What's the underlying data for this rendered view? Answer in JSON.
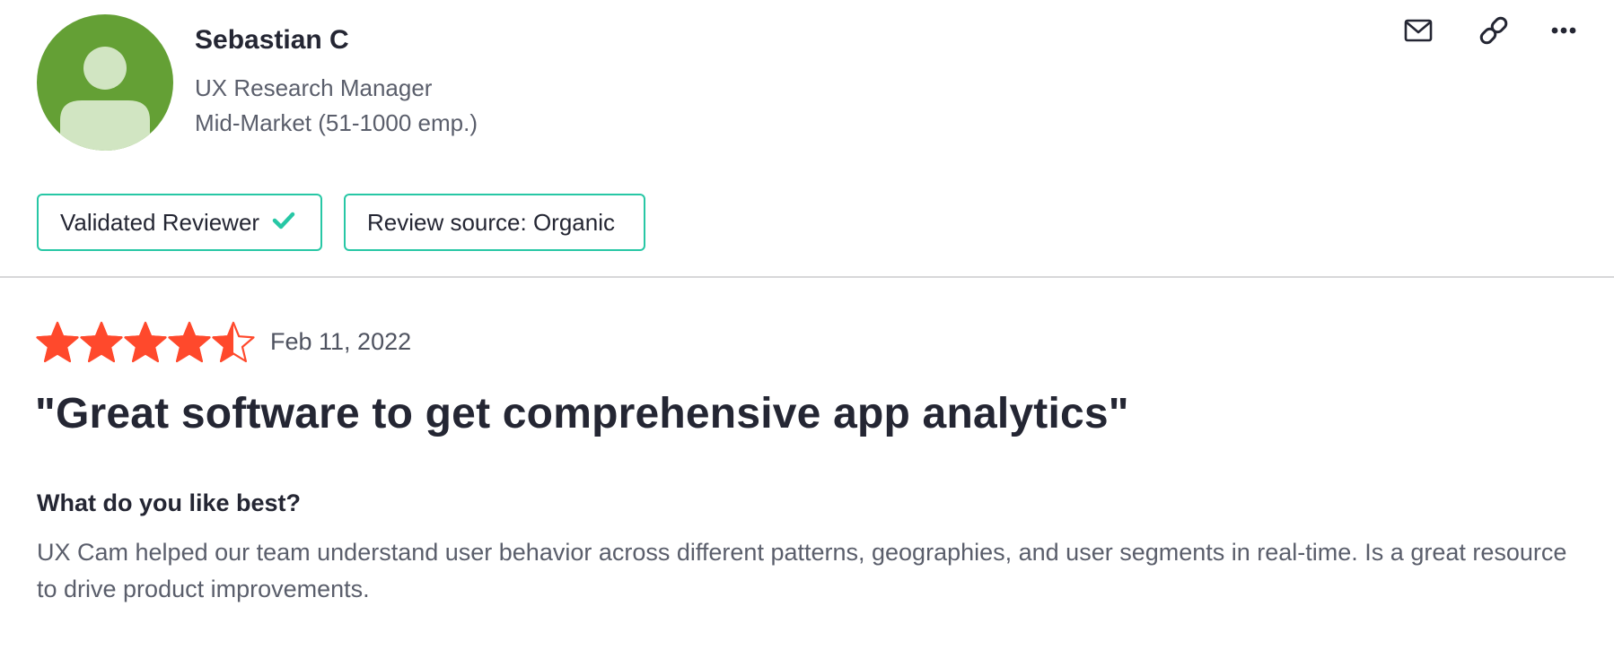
{
  "reviewer": {
    "name": "Sebastian C",
    "title": "UX Research Manager",
    "segment": "Mid-Market (51-1000 emp.)"
  },
  "actions": {
    "email_icon": "envelope-icon",
    "link_icon": "link-icon",
    "more_icon": "more-icon"
  },
  "badges": {
    "validated": "Validated Reviewer",
    "source": "Review source: Organic"
  },
  "review": {
    "rating": 4.5,
    "rating_max": 5,
    "date": "Feb 11, 2022",
    "headline": "\"Great software to get comprehensive app analytics\"",
    "question": "What do you like best?",
    "answer": "UX Cam helped our team understand user behavior across different patterns, geographies, and user segments in real-time. Is a great resource to drive product improvements."
  },
  "colors": {
    "accent": "#27c7a5",
    "star": "#ff492c",
    "avatar_bg": "#64a035",
    "avatar_figure": "#d1e5c2"
  }
}
